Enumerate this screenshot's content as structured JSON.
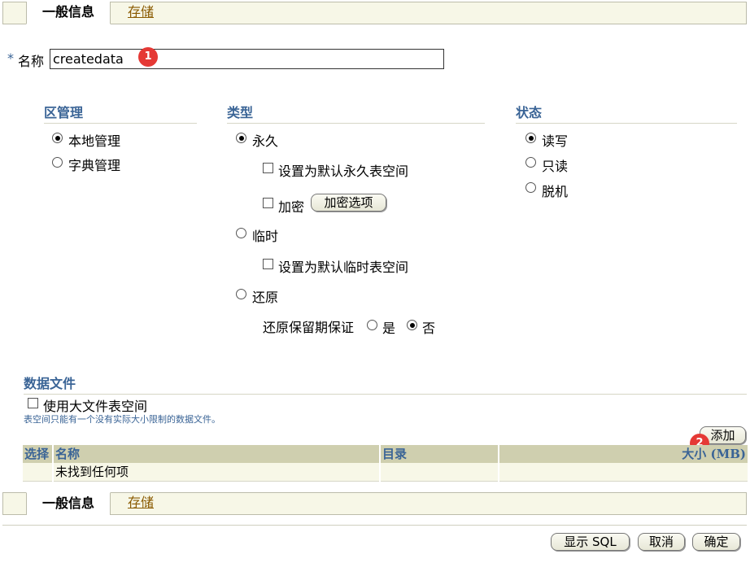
{
  "tabs": [
    {
      "label": "一般信息"
    },
    {
      "label": "存储"
    }
  ],
  "name_field": {
    "required_mark": "*",
    "label": "名称",
    "value": "createdata"
  },
  "badges": [
    "1",
    "2"
  ],
  "extent_mgmt": {
    "title": "区管理",
    "options": [
      {
        "label": "本地管理",
        "checked": true
      },
      {
        "label": "字典管理",
        "checked": false
      }
    ]
  },
  "type": {
    "title": "类型",
    "permanent": {
      "label": "永久",
      "checked": true
    },
    "default_permanent": {
      "label": "设置为默认永久表空间",
      "checked": false
    },
    "encrypt": {
      "label": "加密",
      "checked": false,
      "button": "加密选项"
    },
    "temporary": {
      "label": "临时",
      "checked": false
    },
    "default_temporary": {
      "label": "设置为默认临时表空间",
      "checked": false
    },
    "undo": {
      "label": "还原",
      "checked": false
    },
    "retention": {
      "label": "还原保留期保证",
      "yes": "是",
      "no": "否",
      "selected": "否"
    }
  },
  "status": {
    "title": "状态",
    "options": [
      {
        "label": "读写",
        "checked": true
      },
      {
        "label": "只读",
        "checked": false
      },
      {
        "label": "脱机",
        "checked": false
      }
    ]
  },
  "datafiles": {
    "title": "数据文件",
    "bigfile": {
      "label": "使用大文件表空间",
      "checked": false
    },
    "hint": "表空间只能有一个没有实际大小限制的数据文件。",
    "add_button": "添加",
    "columns": [
      "选择",
      "名称",
      "目录",
      "大小 (MB)"
    ],
    "empty_text": "未找到任何项"
  },
  "footer": {
    "show_sql": "显示 SQL",
    "cancel": "取消",
    "ok": "确定"
  }
}
